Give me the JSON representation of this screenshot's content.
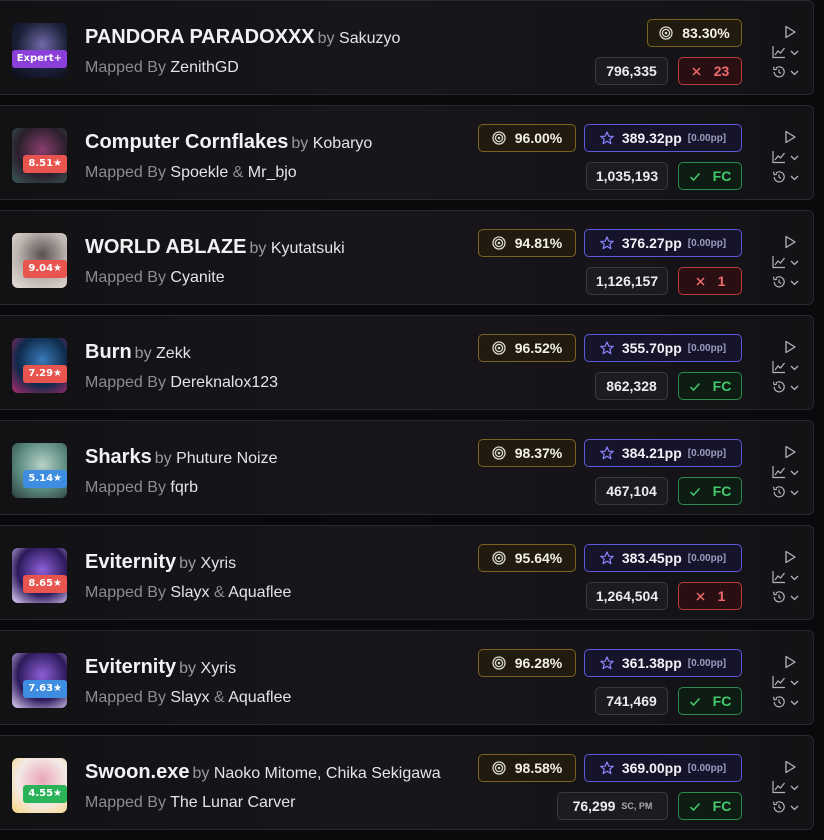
{
  "scores": [
    {
      "title": "PANDORA PARADOXXX",
      "by": "by",
      "artist": "Sakuzyo",
      "mapped_by_label": "Mapped By",
      "mappers": [
        "ZenithGD"
      ],
      "difficulty": "Expert+",
      "difficulty_color": "#8b3fd9",
      "accuracy": "83.30%",
      "pp": null,
      "weighted_pp": null,
      "score": "796,335",
      "score_mods": "",
      "status": "miss",
      "misses": "23",
      "cover_colors": [
        "#1c2038",
        "#6f6aa8",
        "#0b0c18"
      ]
    },
    {
      "title": "Computer Cornflakes",
      "by": "by",
      "artist": "Kobaryo",
      "mapped_by_label": "Mapped By",
      "mappers": [
        "Spoekle",
        "Mr_bjo"
      ],
      "joiner": "&",
      "difficulty": "8.51★",
      "difficulty_color": "#e8544e",
      "accuracy": "96.00%",
      "pp": "389.32pp",
      "weighted_pp": "[0.00pp]",
      "score": "1,035,193",
      "score_mods": "",
      "status": "fc",
      "fc_label": "FC",
      "cover_colors": [
        "#2a1f2c",
        "#8a3e6d",
        "#3a5a5a"
      ]
    },
    {
      "title": "WORLD ABLAZE",
      "by": "by",
      "artist": "Kyutatsuki",
      "mapped_by_label": "Mapped By",
      "mappers": [
        "Cyanite"
      ],
      "difficulty": "9.04★",
      "difficulty_color": "#e8544e",
      "accuracy": "94.81%",
      "pp": "376.27pp",
      "weighted_pp": "[0.00pp]",
      "score": "1,126,157",
      "score_mods": "",
      "status": "miss",
      "misses": "1",
      "cover_colors": [
        "#bdb5b0",
        "#5a4f50",
        "#e6dfda"
      ]
    },
    {
      "title": "Burn",
      "by": "by",
      "artist": "Zekk",
      "mapped_by_label": "Mapped By",
      "mappers": [
        "Dereknalox123"
      ],
      "difficulty": "7.29★",
      "difficulty_color": "#e8544e",
      "accuracy": "96.52%",
      "pp": "355.70pp",
      "weighted_pp": "[0.00pp]",
      "score": "862,328",
      "score_mods": "",
      "status": "fc",
      "fc_label": "FC",
      "cover_colors": [
        "#0d2a4a",
        "#3a7ab8",
        "#b12b6d"
      ]
    },
    {
      "title": "Sharks",
      "by": "by",
      "artist": "Phuture Noize",
      "mapped_by_label": "Mapped By",
      "mappers": [
        "fqrb"
      ],
      "difficulty": "5.14★",
      "difficulty_color": "#3f8de0",
      "accuracy": "98.37%",
      "pp": "384.21pp",
      "weighted_pp": "[0.00pp]",
      "score": "467,104",
      "score_mods": "",
      "status": "fc",
      "fc_label": "FC",
      "cover_colors": [
        "#5a8a7f",
        "#b8d2c8",
        "#2c3d3a"
      ]
    },
    {
      "title": "Eviternity",
      "by": "by",
      "artist": "Xyris",
      "mapped_by_label": "Mapped By",
      "mappers": [
        "Slayx",
        "Aquaflee"
      ],
      "joiner": "&",
      "difficulty": "8.65★",
      "difficulty_color": "#e8544e",
      "accuracy": "95.64%",
      "pp": "383.45pp",
      "weighted_pp": "[0.00pp]",
      "score": "1,264,504",
      "score_mods": "",
      "status": "miss",
      "misses": "1",
      "cover_colors": [
        "#2b1a5a",
        "#8e5fd8",
        "#e6d6ff"
      ]
    },
    {
      "title": "Eviternity",
      "by": "by",
      "artist": "Xyris",
      "mapped_by_label": "Mapped By",
      "mappers": [
        "Slayx",
        "Aquaflee"
      ],
      "joiner": "&",
      "difficulty": "7.63★",
      "difficulty_color": "#3f8de0",
      "accuracy": "96.28%",
      "pp": "361.38pp",
      "weighted_pp": "[0.00pp]",
      "score": "741,469",
      "score_mods": "",
      "status": "fc",
      "fc_label": "FC",
      "cover_colors": [
        "#2b1a5a",
        "#8e5fd8",
        "#e6d6ff"
      ]
    },
    {
      "title": "Swoon.exe",
      "by": "by",
      "artist": "Naoko Mitome, Chika Sekigawa",
      "mapped_by_label": "Mapped By",
      "mappers": [
        "The Lunar Carver"
      ],
      "difficulty": "4.55★",
      "difficulty_color": "#2bb35a",
      "accuracy": "98.58%",
      "pp": "369.00pp",
      "weighted_pp": "[0.00pp]",
      "score": "76,299",
      "score_mods": "SC, PM",
      "status": "fc",
      "fc_label": "FC",
      "cover_colors": [
        "#f4eae6",
        "#e9a6b8",
        "#f6d37a"
      ]
    }
  ],
  "icons": {
    "accuracy": "target-icon",
    "pp": "star-icon",
    "fc": "check-icon",
    "miss": "x-icon",
    "play": "play-icon",
    "graph": "chart-icon",
    "history": "history-icon",
    "chevron": "chevron-down-icon"
  }
}
